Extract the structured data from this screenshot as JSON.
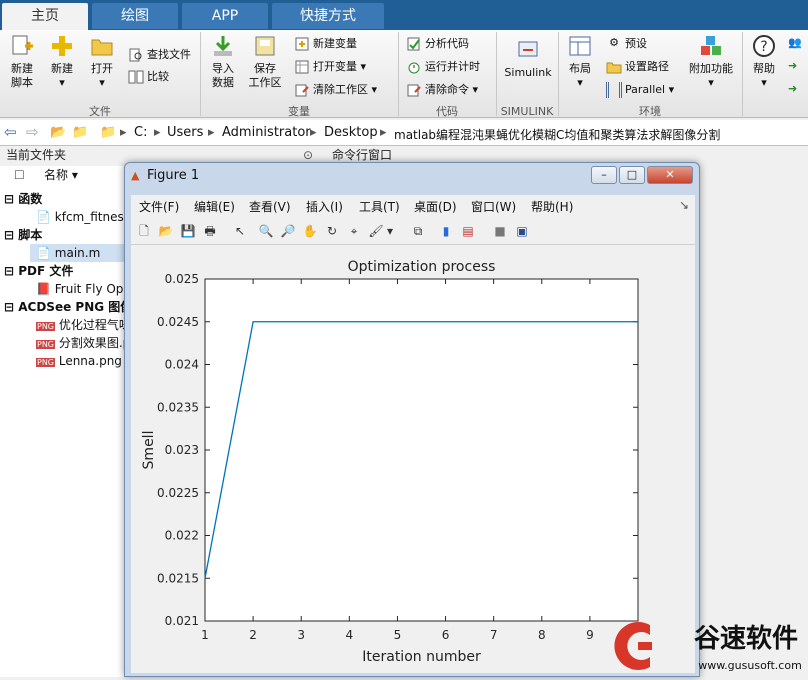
{
  "tabs": [
    "主页",
    "绘图",
    "APP",
    "快捷方式"
  ],
  "ribbon": {
    "new_script": "新建\n脚本",
    "new": "新建",
    "open": "打开",
    "find_files": "查找文件",
    "compare": "比较",
    "import": "导入\n数据",
    "save_ws": "保存\n工作区",
    "new_var": "新建变量",
    "open_var": "打开变量",
    "clear_ws": "清除工作区",
    "analyze": "分析代码",
    "run_time": "运行并计时",
    "clear_cmd": "清除命令",
    "simulink": "Simulink",
    "layout": "布局",
    "prefs": "预设",
    "set_path": "设置路径",
    "parallel": "Parallel",
    "addons": "附加功能",
    "help": "帮助",
    "sections": [
      "文件",
      "变量",
      "代码",
      "SIMULINK",
      "环境"
    ]
  },
  "address": {
    "parts": [
      "C:",
      "Users",
      "Administrator",
      "Desktop",
      "matlab编程混沌果蝇优化模糊C均值和聚类算法求解图像分割"
    ]
  },
  "current_folder": "当前文件夹",
  "command_window": "命令行窗口",
  "name_col": "名称",
  "files": [
    {
      "label": "函数",
      "group": true
    },
    {
      "label": "kfcm_fitness",
      "group": false
    },
    {
      "label": "脚本",
      "group": true
    },
    {
      "label": "main.m",
      "group": false,
      "selected": true
    },
    {
      "label": "PDF 文件",
      "group": true
    },
    {
      "label": "Fruit Fly Op",
      "group": false
    },
    {
      "label": "ACDSee PNG 图像",
      "group": true
    },
    {
      "label": "优化过程气味",
      "group": false
    },
    {
      "label": "分割效果图.p",
      "group": false
    },
    {
      "label": "Lenna.png",
      "group": false
    }
  ],
  "figure": {
    "title": "Figure 1",
    "menu": [
      "文件(F)",
      "编辑(E)",
      "查看(V)",
      "插入(I)",
      "工具(T)",
      "桌面(D)",
      "窗口(W)",
      "帮助(H)"
    ]
  },
  "chart_data": {
    "type": "line",
    "title": "Optimization process",
    "xlabel": "Iteration number",
    "ylabel": "Smell",
    "xlim": [
      1,
      10
    ],
    "ylim": [
      0.021,
      0.025
    ],
    "xticks": [
      1,
      2,
      3,
      4,
      5,
      6,
      7,
      8,
      9
    ],
    "yticks": [
      0.021,
      0.0215,
      0.022,
      0.0225,
      0.023,
      0.0235,
      0.024,
      0.0245,
      0.025
    ],
    "x": [
      1,
      2,
      3,
      4,
      5,
      6,
      7,
      8,
      9,
      10
    ],
    "y": [
      0.0215,
      0.0245,
      0.0245,
      0.0245,
      0.0245,
      0.0245,
      0.0245,
      0.0245,
      0.0245,
      0.0245
    ],
    "grid": false,
    "line_color": "#0072bd"
  },
  "watermark": {
    "text": "谷速软件",
    "url": "www.gususoft.com"
  },
  "colors": {
    "tabbar": "#1f5f96",
    "accent": "#d9362a"
  }
}
